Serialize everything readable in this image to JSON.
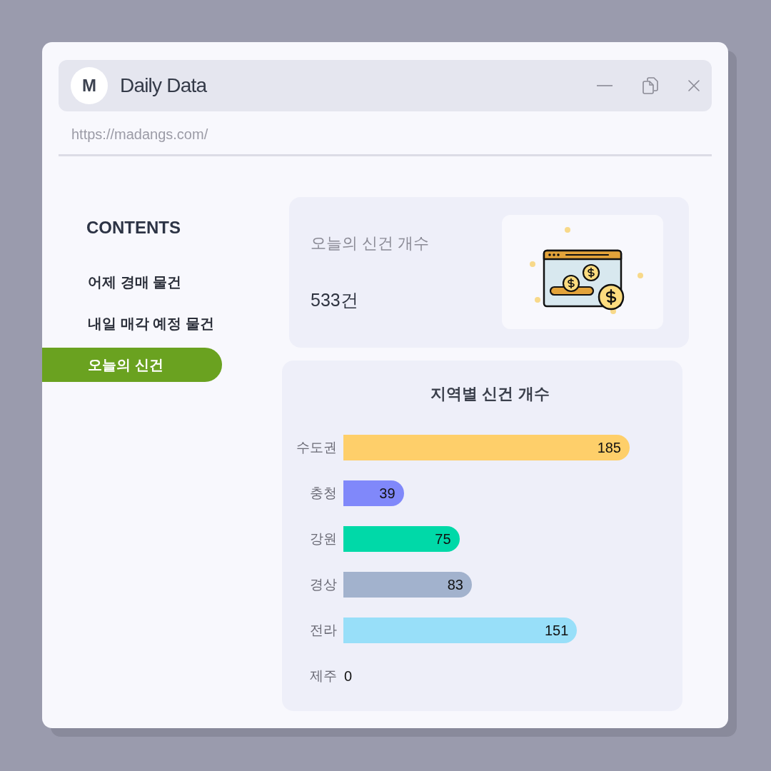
{
  "window": {
    "logo": "M",
    "title": "Daily Data"
  },
  "address_bar": {
    "value": "https://madangs.com/"
  },
  "sidebar": {
    "heading": "CONTENTS",
    "items": [
      {
        "label": "어제 경매 물건",
        "selected": false
      },
      {
        "label": "내일 매각 예정 물건",
        "selected": false
      },
      {
        "label": "오늘의 신건",
        "selected": true
      }
    ]
  },
  "summary_card": {
    "label": "오늘의 신건 개수",
    "value": "533건"
  },
  "chart_card": {
    "chart_data": {
      "type": "bar",
      "title": "지역별 신건 개수",
      "orientation": "horizontal",
      "categories": [
        "수도권",
        "충청",
        "강원",
        "경상",
        "전라",
        "제주"
      ],
      "values": [
        185,
        39,
        75,
        83,
        151,
        0
      ],
      "colors": [
        "#fecf6a",
        "#8088fa",
        "#00d9a8",
        "#a2b2cd",
        "#98dff9",
        null
      ],
      "data_labels": true
    }
  }
}
